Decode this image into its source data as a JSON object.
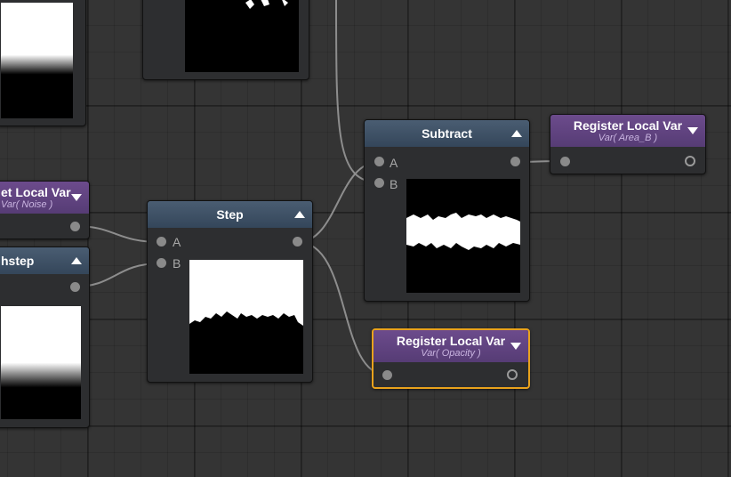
{
  "canvas": {
    "grid": true,
    "background": "#343434"
  },
  "nodes": {
    "step": {
      "title": "Step",
      "input_a": "A",
      "input_b": "B"
    },
    "subtract": {
      "title": "Subtract",
      "input_a": "A",
      "input_b": "B"
    },
    "register_area_b": {
      "title": "Register Local Var",
      "subtitle": "Var( Area_B )"
    },
    "register_opacity": {
      "title": "Register Local Var",
      "subtitle": "Var( Opacity )",
      "selected": true
    },
    "get_noise": {
      "title": "et Local Var",
      "subtitle": "Var( Noise )"
    },
    "smoothstep": {
      "title": "hstep"
    }
  },
  "colors": {
    "header_blue": "#3e5166",
    "header_purple": "#614386",
    "selection": "#e9a21c",
    "wire": "#9a9a9a"
  }
}
